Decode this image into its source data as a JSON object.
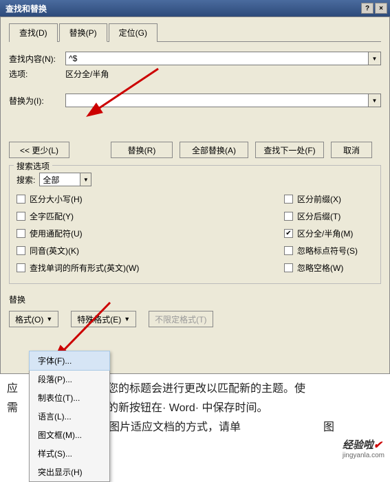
{
  "titlebar": {
    "title": "查找和替换",
    "help": "?",
    "close": "×"
  },
  "tabs": {
    "find": "查找(D)",
    "replace": "替换(P)",
    "goto": "定位(G)"
  },
  "find": {
    "label": "查找内容(N):",
    "value": "^$"
  },
  "options": {
    "label": "选项:",
    "value": "区分全/半角"
  },
  "replace_with": {
    "label": "替换为(I):",
    "value": ""
  },
  "buttons": {
    "less": "<<  更少(L)",
    "replace": "替换(R)",
    "replace_all": "全部替换(A)",
    "find_next": "查找下一处(F)",
    "cancel": "取消"
  },
  "search_opts": {
    "legend": "搜索选项",
    "search_label": "搜索:",
    "search_value": "全部",
    "left": [
      "区分大小写(H)",
      "全字匹配(Y)",
      "使用通配符(U)",
      "同音(英文)(K)",
      "查找单词的所有形式(英文)(W)"
    ],
    "right": [
      {
        "label": "区分前缀(X)",
        "checked": false
      },
      {
        "label": "区分后缀(T)",
        "checked": false
      },
      {
        "label": "区分全/半角(M)",
        "checked": true
      },
      {
        "label": "忽略标点符号(S)",
        "checked": false
      },
      {
        "label": "忽略空格(W)",
        "checked": false
      }
    ]
  },
  "replace_fmt": {
    "legend": "替换",
    "format": "格式(O)",
    "special": "特殊格式(E)",
    "nofmt": "不限定格式(T)"
  },
  "menu": {
    "items": [
      "字体(F)...",
      "段落(P)...",
      "制表位(T)...",
      "语言(L)...",
      "图文框(M)...",
      "样式(S)...",
      "突出显示(H)"
    ]
  },
  "bg_lines": {
    "l1_a": "应",
    "l1_b": "您的标题会进行更改以匹配新的主题。使",
    "l2_a": "需",
    "l2_b": "的新按钮在· Word· 中保存时间。",
    "l3": "图片适应文档的方式，请单",
    "l3_end": "图"
  },
  "watermark": {
    "text": "经验啦",
    "sub": "jingyanla.com"
  }
}
